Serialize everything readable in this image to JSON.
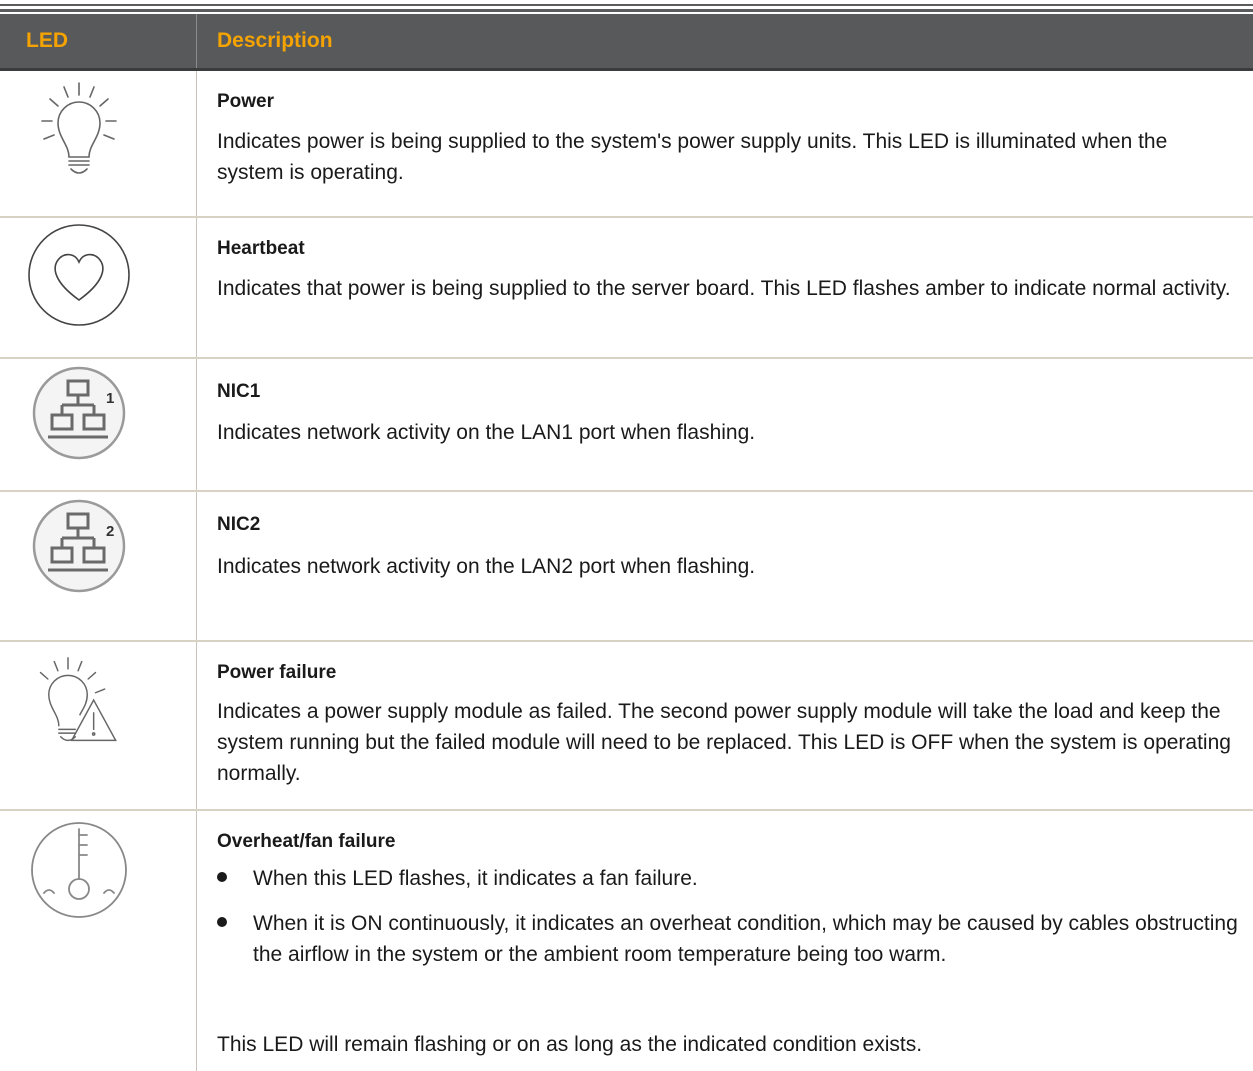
{
  "header": {
    "col_led": "LED",
    "col_description": "Description"
  },
  "rows": [
    {
      "title": "Power",
      "icon": "lightbulb-icon",
      "text": "Indicates power is being supplied to the system's power supply units. This LED is illuminated when the system is operating."
    },
    {
      "title": "Heartbeat",
      "icon": "heart-icon",
      "text": "Indicates that power is being supplied to the server board. This LED flashes amber to indicate normal activity."
    },
    {
      "title": "NIC1",
      "icon": "network-icon",
      "icon_label": "1",
      "text": "Indicates network activity on the LAN1 port when flashing."
    },
    {
      "title": "NIC2",
      "icon": "network-icon",
      "icon_label": "2",
      "text": "Indicates network activity on the LAN2 port when flashing."
    },
    {
      "title": "Power failure",
      "icon": "lightbulb-warning-icon",
      "text": "Indicates a power supply module as failed. The second power supply module will take the load and keep the system running but the failed module will need to be replaced. This LED is OFF when the system is operating normally."
    },
    {
      "title": "Overheat/fan failure",
      "icon": "thermometer-icon",
      "bullets": [
        "When this LED flashes, it indicates a fan failure.",
        "When it is ON continuously, it indicates an overheat condition, which may be caused by cables obstructing the airflow in the system or the ambient room temperature being too warm."
      ],
      "footer": "This LED will remain flashing or on as long as the indicated condition exists."
    }
  ]
}
